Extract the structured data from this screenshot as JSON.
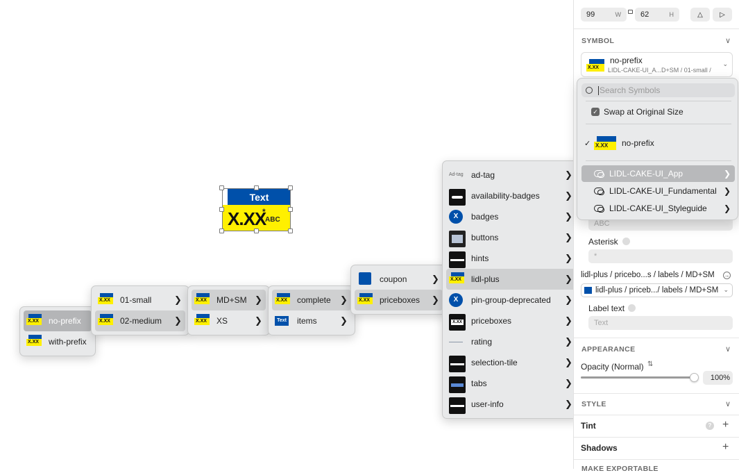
{
  "artwork": {
    "top_text": "Text",
    "price": "X.XX",
    "asterisk": "*",
    "suffix": "ABC"
  },
  "menus": {
    "level0": [
      {
        "label": "no-prefix",
        "thumb": "mini-symbol"
      },
      {
        "label": "with-prefix",
        "thumb": "mini-symbol"
      }
    ],
    "level1": [
      {
        "label": "01-small",
        "thumb": "mini-symbol"
      },
      {
        "label": "02-medium",
        "thumb": "mini-symbol"
      }
    ],
    "level2": [
      {
        "label": "MD+SM",
        "thumb": "mini-symbol"
      },
      {
        "label": "XS",
        "thumb": "mini-symbol"
      }
    ],
    "level3": [
      {
        "label": "complete",
        "thumb": "mini-symbol"
      },
      {
        "label": "items",
        "thumb": "blue-text-badge",
        "thumb_text": "Text"
      }
    ],
    "level4": [
      {
        "label": "coupon",
        "thumb": "coupon-icon"
      },
      {
        "label": "priceboxes",
        "thumb": "mini-symbol"
      }
    ],
    "level5": [
      {
        "label": "ad-tag",
        "thumb": "ad-tag-text",
        "thumb_text": "Ad-tag"
      },
      {
        "label": "availability-badges",
        "thumb": "black-pill"
      },
      {
        "label": "badges",
        "thumb": "blue-circle-x"
      },
      {
        "label": "buttons",
        "thumb": "gray-box"
      },
      {
        "label": "hints",
        "thumb": "black-bar"
      },
      {
        "label": "lidl-plus",
        "thumb": "mini-symbol"
      },
      {
        "label": "pin-group-deprecated",
        "thumb": "blue-circle-x"
      },
      {
        "label": "priceboxes",
        "thumb": "black-price"
      },
      {
        "label": "rating",
        "thumb": "thin-line"
      },
      {
        "label": "selection-tile",
        "thumb": "black-bar"
      },
      {
        "label": "tabs",
        "thumb": "blue-tabs"
      },
      {
        "label": "user-info",
        "thumb": "black-bar"
      }
    ]
  },
  "panel": {
    "width_value": "99",
    "width_unit": "W",
    "height_value": "62",
    "height_unit": "H",
    "symbol_section": "SYMBOL",
    "symbol_name": "no-prefix",
    "symbol_path": "LIDL-CAKE-UI_A...D+SM / 01-small /",
    "search_placeholder": "Search Symbols",
    "swap_label": "Swap at Original Size",
    "current_symbol": "no-prefix",
    "libraries": [
      "LIDL-CAKE-UI_App",
      "LIDL-CAKE-UI_Fundamental",
      "LIDL-CAKE-UI_Styleguide"
    ],
    "abc_placeholder": "ABC",
    "asterisk_label": "Asterisk",
    "asterisk_placeholder": "*",
    "override_path": "lidl-plus / pricebo...s / labels / MD+SM",
    "override_value": "lidl-plus / priceb.../ labels / MD+SM",
    "label_text_label": "Label text",
    "label_text_placeholder": "Text",
    "appearance_section": "APPEARANCE",
    "opacity_label": "Opacity (Normal)",
    "opacity_value": "100%",
    "opacity": 1.0,
    "style_section": "STYLE",
    "tint_label": "Tint",
    "shadows_label": "Shadows",
    "make_exportable": "MAKE EXPORTABLE"
  },
  "colors": {
    "brand_blue": "#0050aa",
    "brand_yellow": "#fff000"
  }
}
